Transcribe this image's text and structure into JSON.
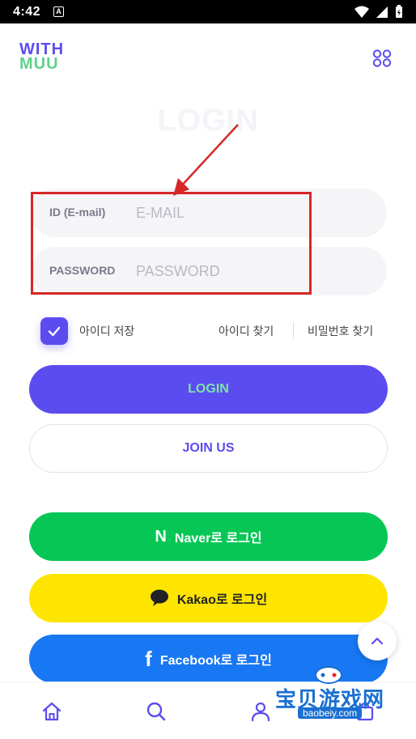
{
  "status": {
    "time": "4:42",
    "notif": "A"
  },
  "logo": {
    "line1": "WITH",
    "line2": "MUU"
  },
  "page": {
    "title": "LOGIN"
  },
  "form": {
    "id_label": "ID (E-mail)",
    "id_placeholder": "E-MAIL",
    "password_label": "PASSWORD",
    "password_placeholder": "PASSWORD"
  },
  "options": {
    "save_id": "아이디 저장",
    "find_id": "아이디 찾기",
    "find_password": "비밀번호 찾기",
    "save_id_checked": true
  },
  "buttons": {
    "login": "LOGIN",
    "join": "JOIN US",
    "naver": "Naver로 로그인",
    "naver_icon_letter": "N",
    "kakao": "Kakao로 로그인",
    "facebook": "Facebook로 로그인",
    "facebook_icon_letter": "f"
  },
  "watermark": {
    "main": "宝贝游戏网",
    "sub": "baobeiy.com"
  },
  "colors": {
    "brand": "#5b4cf0",
    "brand_green": "#5fd28a",
    "naver": "#06c755",
    "kakao": "#fee500",
    "facebook": "#1877f2",
    "annotation": "#d62727"
  },
  "icons": [
    "menu-grid-icon",
    "check-icon",
    "chevron-up-icon",
    "home-icon",
    "search-icon",
    "user-icon",
    "cart-icon",
    "naver-icon",
    "kakao-chat-icon",
    "facebook-icon"
  ]
}
